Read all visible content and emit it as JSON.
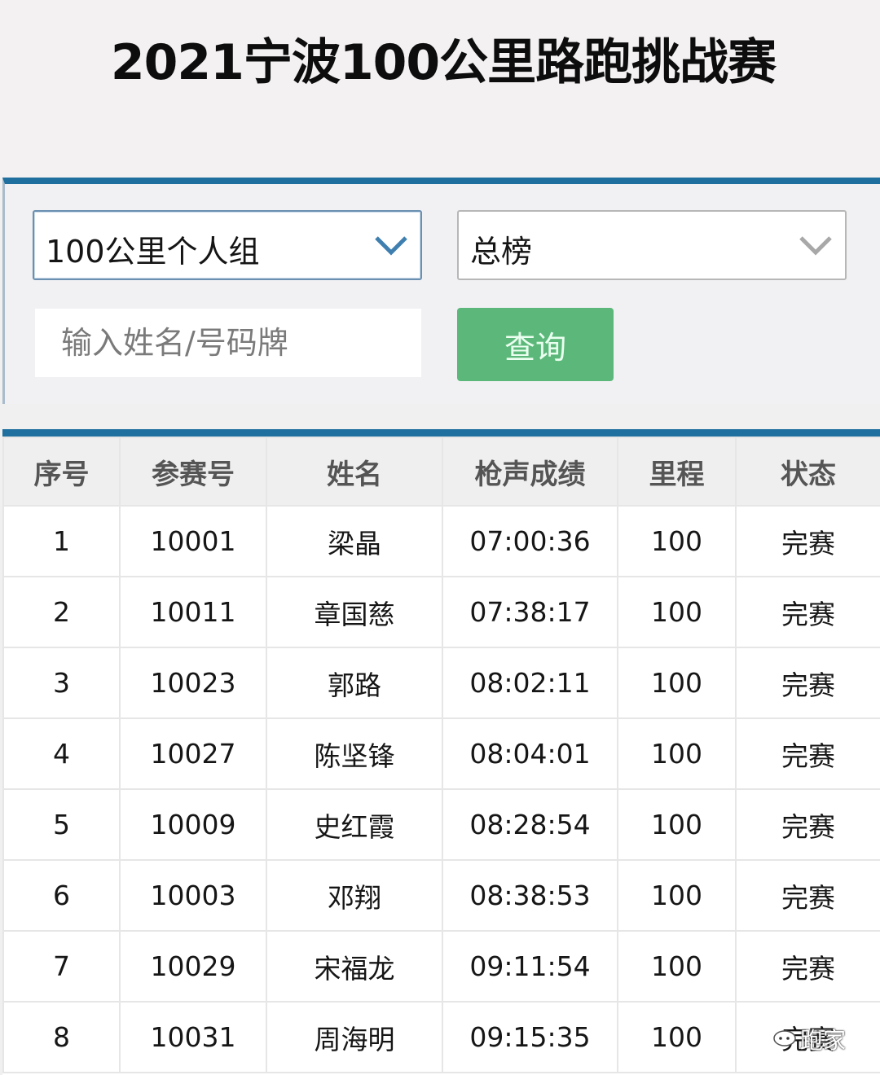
{
  "header": {
    "title": "2021宁波100公里路跑挑战赛"
  },
  "filters": {
    "group_select": {
      "value": "100公里个人组",
      "icon": "chevron-down-icon"
    },
    "board_select": {
      "value": "总榜",
      "icon": "chevron-down-icon"
    },
    "search": {
      "placeholder": "输入姓名/号码牌",
      "value": ""
    },
    "query_button": {
      "label": "查询"
    }
  },
  "colors": {
    "accent_bar": "#1f6f9f",
    "query_button": "#5cb87a"
  },
  "table": {
    "columns": [
      "序号",
      "参赛号",
      "姓名",
      "枪声成绩",
      "里程",
      "状态"
    ],
    "rows": [
      [
        "1",
        "10001",
        "梁晶",
        "07:00:36",
        "100",
        "完赛"
      ],
      [
        "2",
        "10011",
        "章国慈",
        "07:38:17",
        "100",
        "完赛"
      ],
      [
        "3",
        "10023",
        "郭路",
        "08:02:11",
        "100",
        "完赛"
      ],
      [
        "4",
        "10027",
        "陈坚锋",
        "08:04:01",
        "100",
        "完赛"
      ],
      [
        "5",
        "10009",
        "史红霞",
        "08:28:54",
        "100",
        "完赛"
      ],
      [
        "6",
        "10003",
        "邓翔",
        "08:38:53",
        "100",
        "完赛"
      ],
      [
        "7",
        "10029",
        "宋福龙",
        "09:11:54",
        "100",
        "完赛"
      ],
      [
        "8",
        "10031",
        "周海明",
        "09:15:35",
        "100",
        "完赛"
      ]
    ]
  },
  "watermark": {
    "text": "跑家",
    "icon": "wechat-icon"
  }
}
